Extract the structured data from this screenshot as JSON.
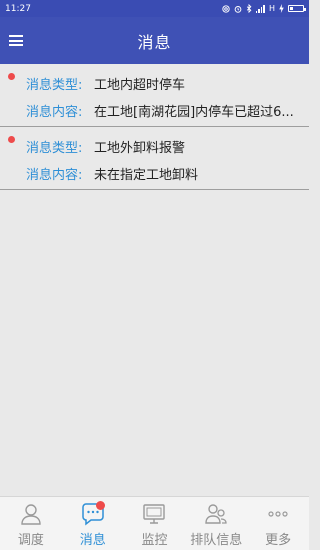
{
  "status_bar": {
    "time": "11:27",
    "network": "H"
  },
  "app_bar": {
    "title": "消息"
  },
  "messages": [
    {
      "unread": true,
      "type_label": "消息类型:",
      "type_value": "工地内超时停车",
      "content_label": "消息内容:",
      "content_value": "在工地[南湖花园]内停车已超过6..."
    },
    {
      "unread": true,
      "type_label": "消息类型:",
      "type_value": "工地外卸料报警",
      "content_label": "消息内容:",
      "content_value": "未在指定工地卸料"
    }
  ],
  "tabs": [
    {
      "label": "调度",
      "icon": "person-icon",
      "active": false
    },
    {
      "label": "消息",
      "icon": "chat-bubble-icon",
      "active": true,
      "badge": true
    },
    {
      "label": "监控",
      "icon": "monitor-icon",
      "active": false
    },
    {
      "label": "排队信息",
      "icon": "people-icon",
      "active": false
    },
    {
      "label": "更多",
      "icon": "more-dots-icon",
      "active": false
    }
  ],
  "colors": {
    "primary": "#3f51b5",
    "accent": "#2e8fd6",
    "badge": "#ee4b4b"
  }
}
